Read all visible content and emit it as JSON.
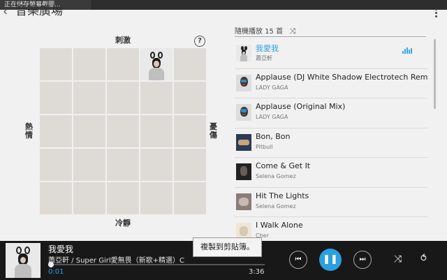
{
  "status": {
    "text": "正在儲存螢幕截圖..."
  },
  "appbar": {
    "back_icon": "back-arrow-icon",
    "title": "音樂廣場",
    "menu_icon": "overflow-menu-icon"
  },
  "mood": {
    "top": "刺激",
    "bottom": "冷靜",
    "left": "熱情",
    "right": "憂傷",
    "help_label": "?",
    "active_cell": {
      "row": 0,
      "col": 3
    }
  },
  "playlist": {
    "header": "隨機播放 15 首",
    "shuffle_icon": "shuffle-icon",
    "items": [
      {
        "title": "我愛我",
        "artist": "蕭亞軒",
        "active": true
      },
      {
        "title": "Applause (DJ White Shadow Electrotech Remix)",
        "artist": "LADY GAGA"
      },
      {
        "title": "Applause (Original Mix)",
        "artist": "LADY GAGA"
      },
      {
        "title": "Bon, Bon",
        "artist": "Pitbull"
      },
      {
        "title": "Come & Get It",
        "artist": "Selena Gomez"
      },
      {
        "title": "Hit The Lights",
        "artist": "Selena Gomez"
      },
      {
        "title": "I Walk Alone",
        "artist": "Cher"
      }
    ]
  },
  "player": {
    "title": "我愛我",
    "subtitle": "蕭亞軒 / Super Girl愛無畏（新歌+精選）C",
    "current_time": "0:01",
    "total_time": "3:36",
    "progress": 0.005,
    "prev_icon": "skip-previous-icon",
    "play_icon": "pause-icon",
    "next_icon": "skip-next-icon",
    "shuffle_icon": "shuffle-icon",
    "repeat_icon": "repeat-icon"
  },
  "toast": {
    "text": "複製到剪貼簿。"
  },
  "colors": {
    "accent": "#2aa0e0",
    "player_bg": "#181818",
    "grid_cell": "#dedbd6"
  }
}
